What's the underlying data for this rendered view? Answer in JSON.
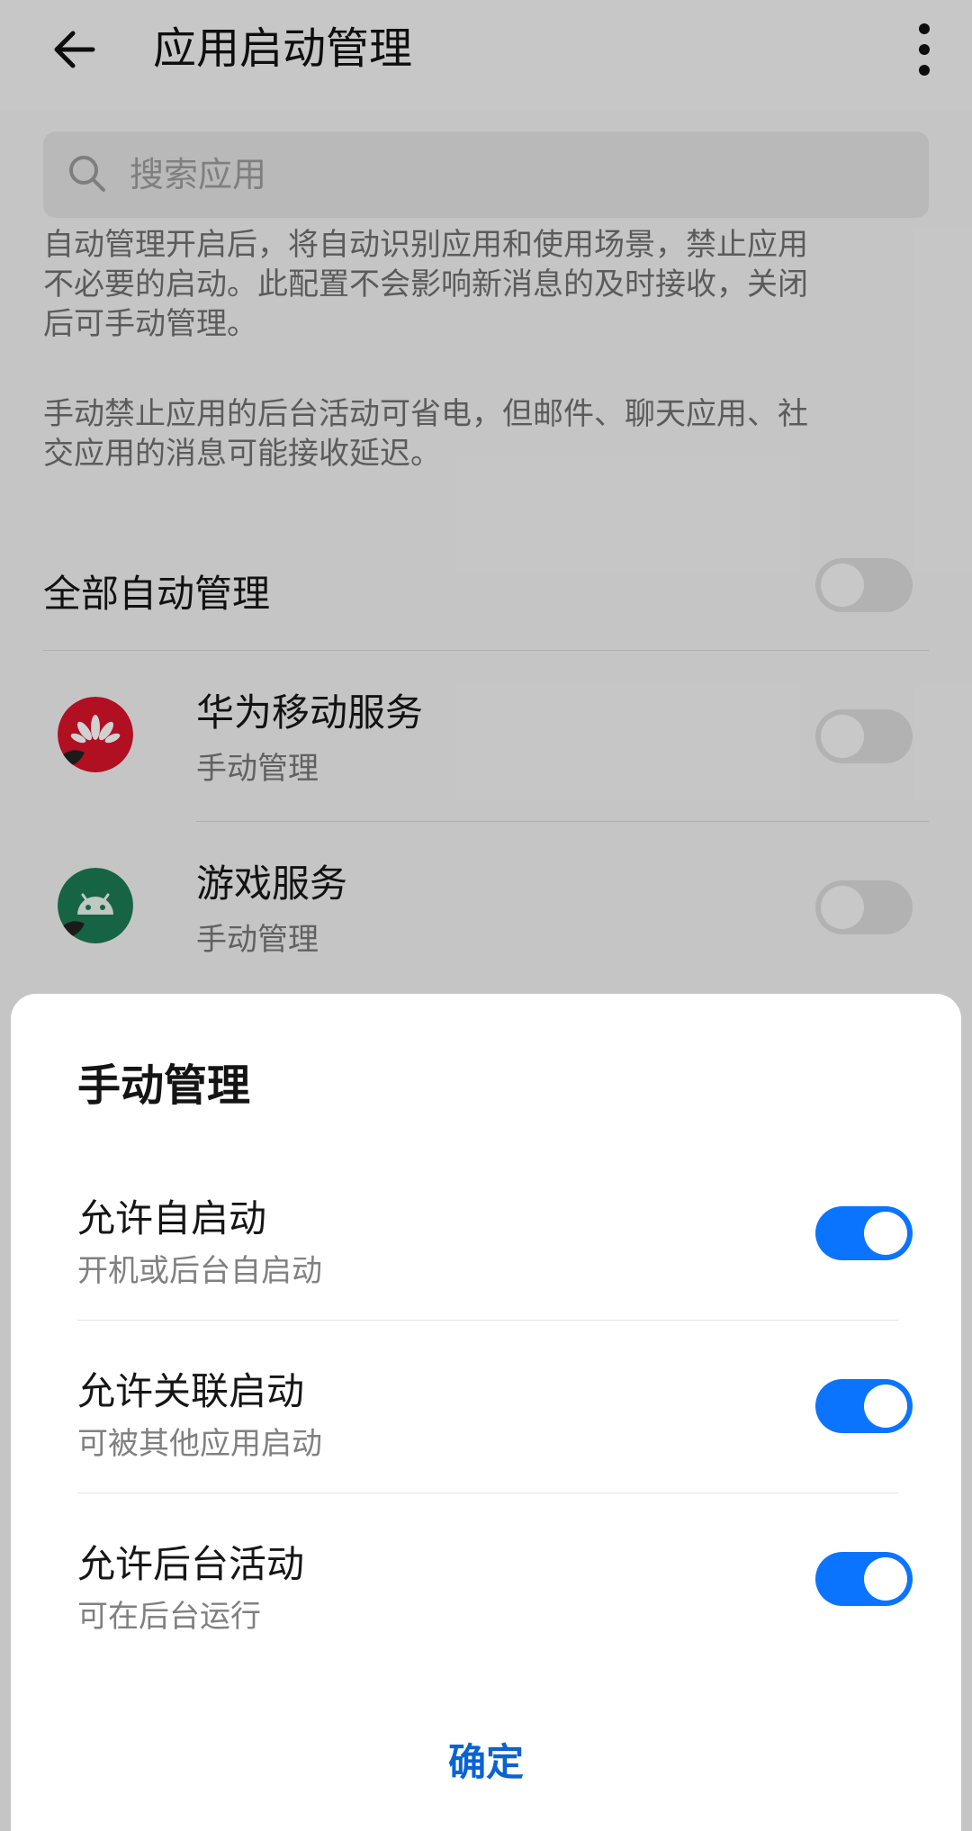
{
  "header": {
    "title": "应用启动管理"
  },
  "search": {
    "placeholder": "搜索应用"
  },
  "description": {
    "lines": [
      "自动管理开启后，将自动识别应用和使用场景，禁止应用",
      "不必要的启动。此配置不会影响新消息的及时接收，关闭",
      "后可手动管理。"
    ],
    "manual_lines": [
      "手动禁止应用的后台活动可省电，但邮件、聊天应用、社",
      "交应用的消息可能接收延迟。"
    ]
  },
  "all_auto": {
    "label": "全部自动管理",
    "enabled": false
  },
  "apps": [
    {
      "name": "华为移动服务",
      "status": "手动管理",
      "icon": "huawei-icon",
      "enabled": false,
      "color": "#d8132a"
    },
    {
      "name": "游戏服务",
      "status": "手动管理",
      "icon": "android-icon",
      "enabled": false,
      "color": "#1c7b54"
    }
  ],
  "sheet": {
    "title": "手动管理",
    "options": [
      {
        "title": "允许自启动",
        "subtitle": "开机或后台自启动",
        "enabled": true
      },
      {
        "title": "允许关联启动",
        "subtitle": "可被其他应用启动",
        "enabled": true
      },
      {
        "title": "允许后台活动",
        "subtitle": "可在后台运行",
        "enabled": true
      }
    ],
    "confirm_label": "确定"
  },
  "colors": {
    "accent": "#0a74ff",
    "confirm_text": "#0a63d1"
  }
}
